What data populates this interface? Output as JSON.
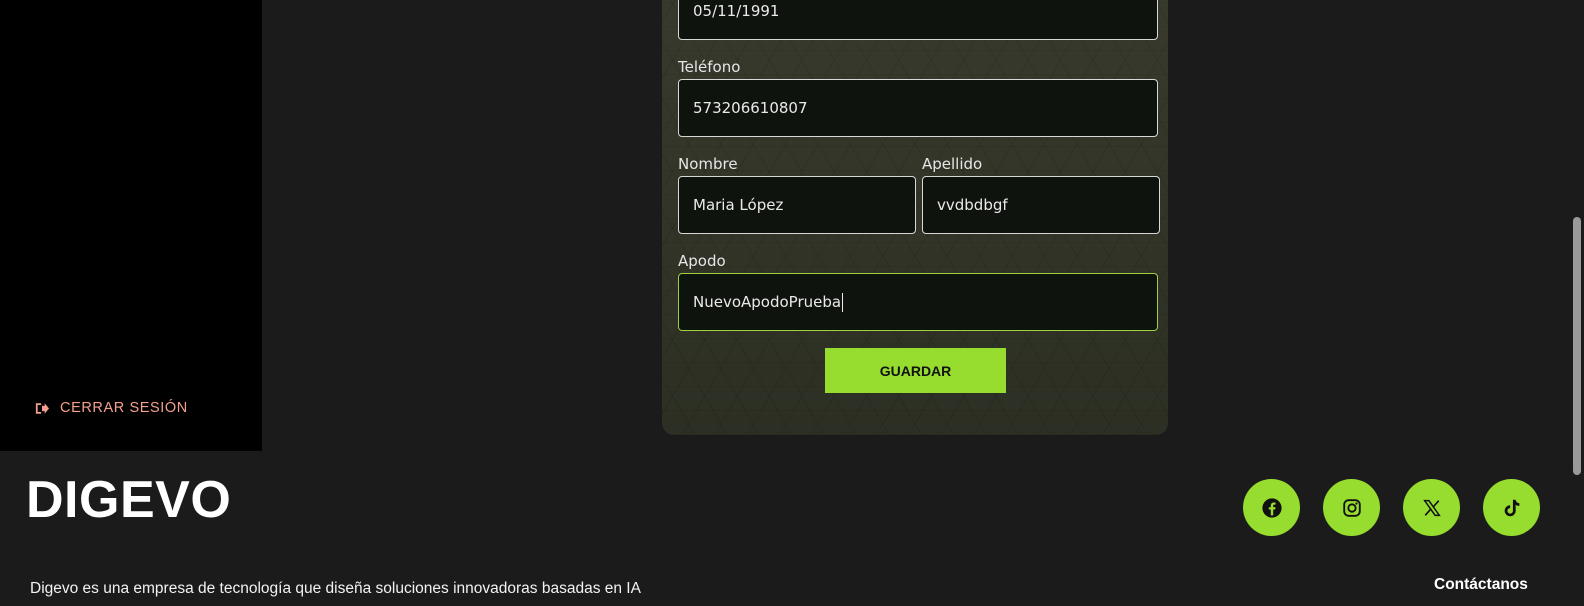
{
  "sidebar": {
    "logout_label": "CERRAR SESIÓN",
    "logout_icon": "sign-out-icon"
  },
  "form": {
    "birthdate_value": "05/11/1991",
    "phone_label": "Teléfono",
    "phone_value": "573206610807",
    "first_name_label": "Nombre",
    "first_name_value": "Maria López",
    "last_name_label": "Apellido",
    "last_name_value": "vvdbdbgf",
    "nickname_label": "Apodo",
    "nickname_value": "NuevoApodoPrueba",
    "save_label": "GUARDAR"
  },
  "footer": {
    "brand": "DIGEVO",
    "description": "Digevo es una empresa de tecnología que diseña soluciones innovadoras basadas en IA",
    "contact_label": "Contáctanos",
    "socials": [
      "facebook-icon",
      "instagram-icon",
      "x-icon",
      "tiktok-icon"
    ]
  },
  "colors": {
    "accent": "#96dd2f",
    "logout": "#f5a08e",
    "background": "#1b1b1c",
    "sidebar": "#000000"
  }
}
